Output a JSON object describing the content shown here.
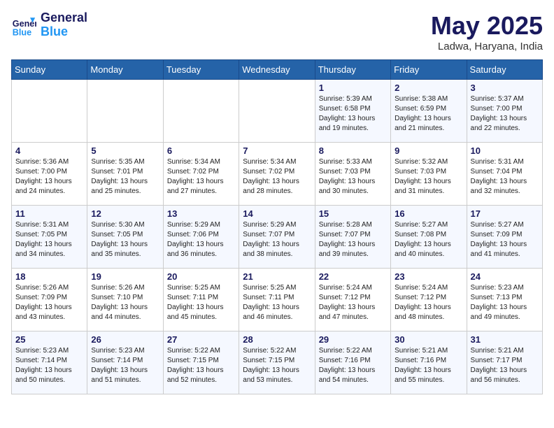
{
  "header": {
    "logo_line1": "General",
    "logo_line2": "Blue",
    "month": "May 2025",
    "location": "Ladwa, Haryana, India"
  },
  "weekdays": [
    "Sunday",
    "Monday",
    "Tuesday",
    "Wednesday",
    "Thursday",
    "Friday",
    "Saturday"
  ],
  "weeks": [
    [
      {
        "day": "",
        "info": ""
      },
      {
        "day": "",
        "info": ""
      },
      {
        "day": "",
        "info": ""
      },
      {
        "day": "",
        "info": ""
      },
      {
        "day": "1",
        "info": "Sunrise: 5:39 AM\nSunset: 6:58 PM\nDaylight: 13 hours\nand 19 minutes."
      },
      {
        "day": "2",
        "info": "Sunrise: 5:38 AM\nSunset: 6:59 PM\nDaylight: 13 hours\nand 21 minutes."
      },
      {
        "day": "3",
        "info": "Sunrise: 5:37 AM\nSunset: 7:00 PM\nDaylight: 13 hours\nand 22 minutes."
      }
    ],
    [
      {
        "day": "4",
        "info": "Sunrise: 5:36 AM\nSunset: 7:00 PM\nDaylight: 13 hours\nand 24 minutes."
      },
      {
        "day": "5",
        "info": "Sunrise: 5:35 AM\nSunset: 7:01 PM\nDaylight: 13 hours\nand 25 minutes."
      },
      {
        "day": "6",
        "info": "Sunrise: 5:34 AM\nSunset: 7:02 PM\nDaylight: 13 hours\nand 27 minutes."
      },
      {
        "day": "7",
        "info": "Sunrise: 5:34 AM\nSunset: 7:02 PM\nDaylight: 13 hours\nand 28 minutes."
      },
      {
        "day": "8",
        "info": "Sunrise: 5:33 AM\nSunset: 7:03 PM\nDaylight: 13 hours\nand 30 minutes."
      },
      {
        "day": "9",
        "info": "Sunrise: 5:32 AM\nSunset: 7:03 PM\nDaylight: 13 hours\nand 31 minutes."
      },
      {
        "day": "10",
        "info": "Sunrise: 5:31 AM\nSunset: 7:04 PM\nDaylight: 13 hours\nand 32 minutes."
      }
    ],
    [
      {
        "day": "11",
        "info": "Sunrise: 5:31 AM\nSunset: 7:05 PM\nDaylight: 13 hours\nand 34 minutes."
      },
      {
        "day": "12",
        "info": "Sunrise: 5:30 AM\nSunset: 7:05 PM\nDaylight: 13 hours\nand 35 minutes."
      },
      {
        "day": "13",
        "info": "Sunrise: 5:29 AM\nSunset: 7:06 PM\nDaylight: 13 hours\nand 36 minutes."
      },
      {
        "day": "14",
        "info": "Sunrise: 5:29 AM\nSunset: 7:07 PM\nDaylight: 13 hours\nand 38 minutes."
      },
      {
        "day": "15",
        "info": "Sunrise: 5:28 AM\nSunset: 7:07 PM\nDaylight: 13 hours\nand 39 minutes."
      },
      {
        "day": "16",
        "info": "Sunrise: 5:27 AM\nSunset: 7:08 PM\nDaylight: 13 hours\nand 40 minutes."
      },
      {
        "day": "17",
        "info": "Sunrise: 5:27 AM\nSunset: 7:09 PM\nDaylight: 13 hours\nand 41 minutes."
      }
    ],
    [
      {
        "day": "18",
        "info": "Sunrise: 5:26 AM\nSunset: 7:09 PM\nDaylight: 13 hours\nand 43 minutes."
      },
      {
        "day": "19",
        "info": "Sunrise: 5:26 AM\nSunset: 7:10 PM\nDaylight: 13 hours\nand 44 minutes."
      },
      {
        "day": "20",
        "info": "Sunrise: 5:25 AM\nSunset: 7:11 PM\nDaylight: 13 hours\nand 45 minutes."
      },
      {
        "day": "21",
        "info": "Sunrise: 5:25 AM\nSunset: 7:11 PM\nDaylight: 13 hours\nand 46 minutes."
      },
      {
        "day": "22",
        "info": "Sunrise: 5:24 AM\nSunset: 7:12 PM\nDaylight: 13 hours\nand 47 minutes."
      },
      {
        "day": "23",
        "info": "Sunrise: 5:24 AM\nSunset: 7:12 PM\nDaylight: 13 hours\nand 48 minutes."
      },
      {
        "day": "24",
        "info": "Sunrise: 5:23 AM\nSunset: 7:13 PM\nDaylight: 13 hours\nand 49 minutes."
      }
    ],
    [
      {
        "day": "25",
        "info": "Sunrise: 5:23 AM\nSunset: 7:14 PM\nDaylight: 13 hours\nand 50 minutes."
      },
      {
        "day": "26",
        "info": "Sunrise: 5:23 AM\nSunset: 7:14 PM\nDaylight: 13 hours\nand 51 minutes."
      },
      {
        "day": "27",
        "info": "Sunrise: 5:22 AM\nSunset: 7:15 PM\nDaylight: 13 hours\nand 52 minutes."
      },
      {
        "day": "28",
        "info": "Sunrise: 5:22 AM\nSunset: 7:15 PM\nDaylight: 13 hours\nand 53 minutes."
      },
      {
        "day": "29",
        "info": "Sunrise: 5:22 AM\nSunset: 7:16 PM\nDaylight: 13 hours\nand 54 minutes."
      },
      {
        "day": "30",
        "info": "Sunrise: 5:21 AM\nSunset: 7:16 PM\nDaylight: 13 hours\nand 55 minutes."
      },
      {
        "day": "31",
        "info": "Sunrise: 5:21 AM\nSunset: 7:17 PM\nDaylight: 13 hours\nand 56 minutes."
      }
    ]
  ]
}
